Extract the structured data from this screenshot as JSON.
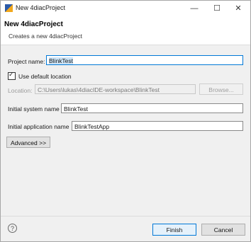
{
  "window": {
    "title": "New 4diacProject",
    "minimize_icon": "minimize-icon",
    "maximize_icon": "maximize-icon",
    "close_icon": "close-icon"
  },
  "header": {
    "title": "New 4diacProject",
    "description": "Creates a new 4diacProject"
  },
  "form": {
    "project_name_label": "Project name:",
    "project_name_value": "BlinkTest",
    "use_default_label": "Use default location",
    "use_default_checked": true,
    "location_label": "Location:",
    "location_value": "C:\\Users\\lukas\\4diacIDE-workspace\\BlinkTest",
    "browse_label": "Browse...",
    "system_name_label": "Initial system name",
    "system_name_value": "BlinkTest",
    "app_name_label": "Initial application name",
    "app_name_value": "BlinkTestApp",
    "advanced_label": "Advanced >>"
  },
  "footer": {
    "help_glyph": "?",
    "finish_label": "Finish",
    "cancel_label": "Cancel"
  },
  "colors": {
    "accent": "#0078d7",
    "background": "#f0f0f0"
  }
}
